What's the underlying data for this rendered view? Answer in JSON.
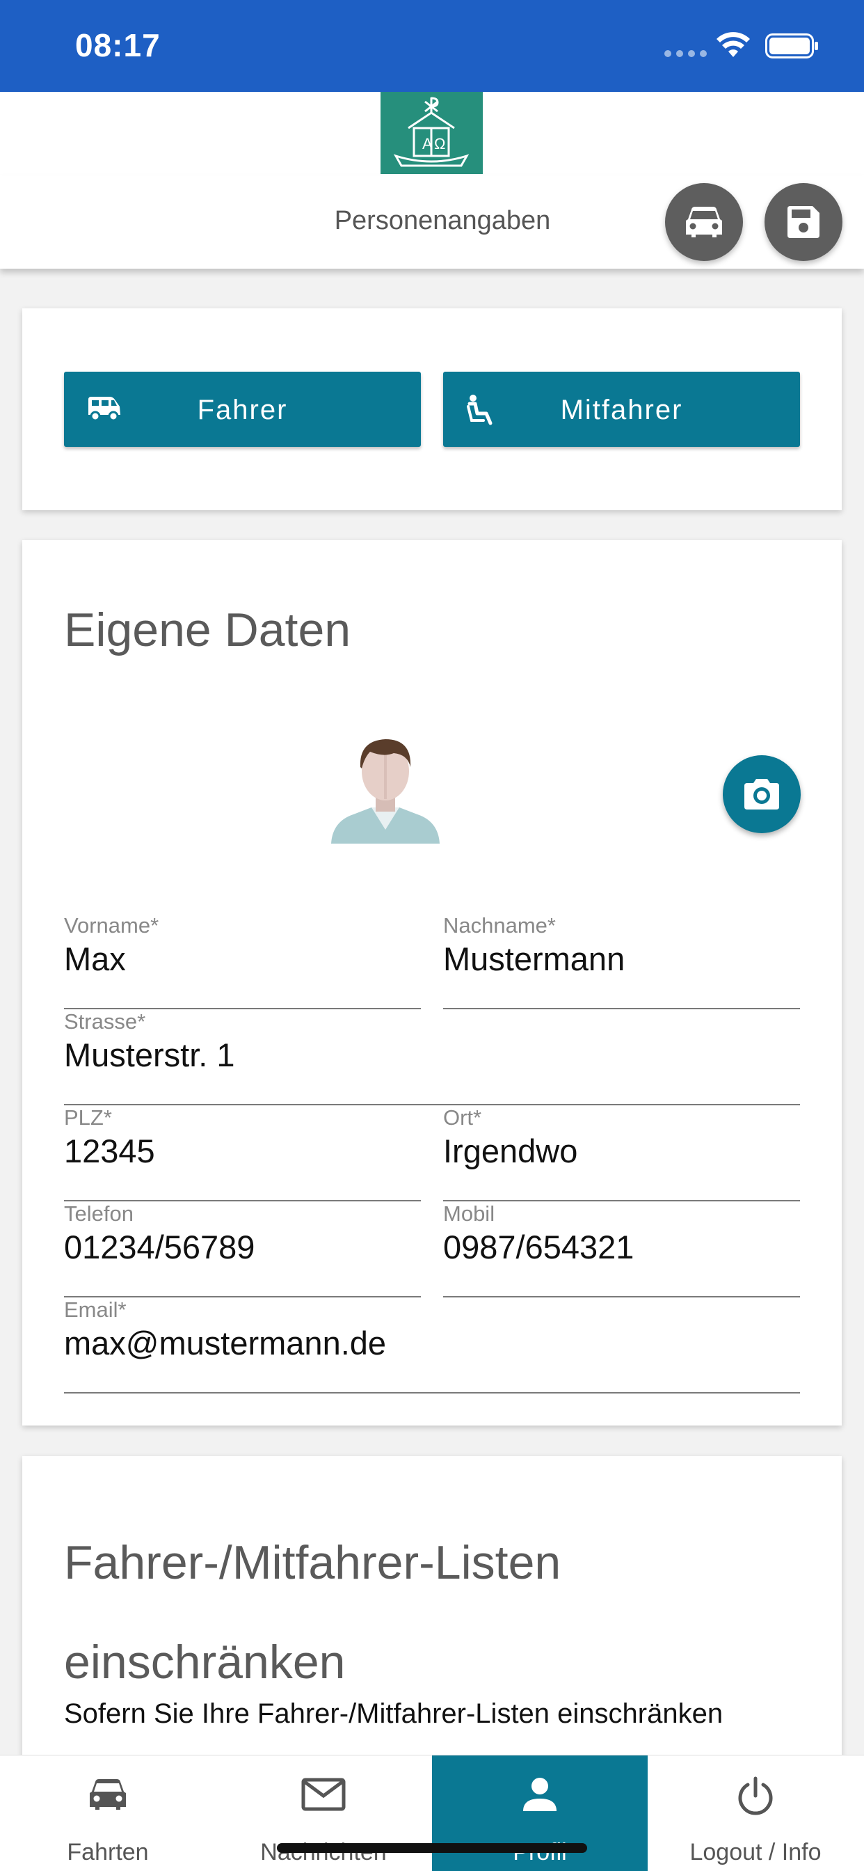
{
  "status_bar": {
    "time": "08:17"
  },
  "header": {
    "title": "Personenangaben"
  },
  "roles": {
    "driver_label": "Fahrer",
    "passenger_label": "Mitfahrer"
  },
  "profile": {
    "title": "Eigene Daten",
    "fields": {
      "vorname": {
        "label": "Vorname*",
        "value": "Max"
      },
      "nachname": {
        "label": "Nachname*",
        "value": "Mustermann"
      },
      "strasse": {
        "label": "Strasse*",
        "value": "Musterstr. 1"
      },
      "plz": {
        "label": "PLZ*",
        "value": "12345"
      },
      "ort": {
        "label": "Ort*",
        "value": "Irgendwo"
      },
      "telefon": {
        "label": "Telefon",
        "value": "01234/56789"
      },
      "mobil": {
        "label": "Mobil",
        "value": "0987/654321"
      },
      "email": {
        "label": "Email*",
        "value": "max@mustermann.de"
      }
    }
  },
  "restrict": {
    "title": "Fahrer-/Mitfahrer-Listen einschränken",
    "description": "Sofern Sie Ihre Fahrer-/Mitfahrer-Listen einschränken"
  },
  "tabbar": {
    "tabs": [
      {
        "label": "Fahrten",
        "icon": "car-icon",
        "active": false
      },
      {
        "label": "Nachrichten",
        "icon": "mail-icon",
        "active": false
      },
      {
        "label": "Profil",
        "icon": "person-icon",
        "active": true
      },
      {
        "label": "Logout / Info",
        "icon": "power-icon",
        "active": false
      }
    ]
  },
  "colors": {
    "status_bar": "#1e5fc4",
    "accent": "#0a7893",
    "logo": "#268f7c",
    "round_button": "#5e5e5e"
  }
}
